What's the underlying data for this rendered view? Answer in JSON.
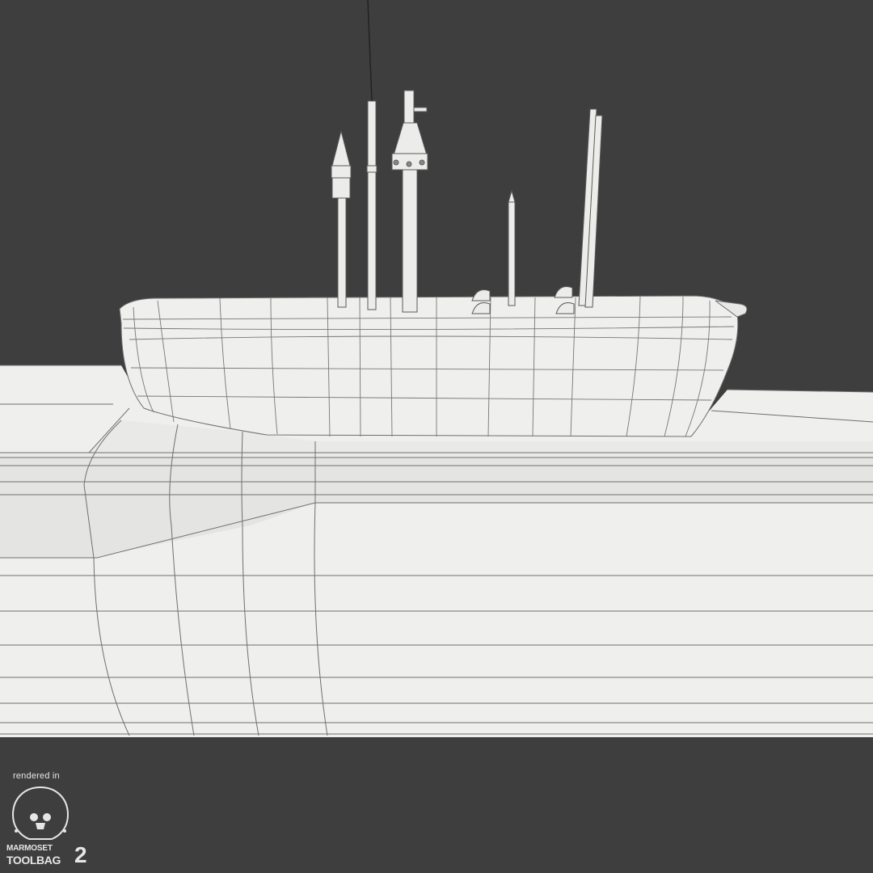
{
  "watermark": {
    "rendered_in": "rendered in",
    "brand_line1": "MARMOSET",
    "brand_line2": "TOOLBAG",
    "version": "2"
  },
  "colors": {
    "background": "#3e3e3e",
    "hull": "#efefee",
    "hull_shade": "#e2e2e0",
    "wire": "#6f6f6f",
    "watermark": "#e6e6e6"
  }
}
